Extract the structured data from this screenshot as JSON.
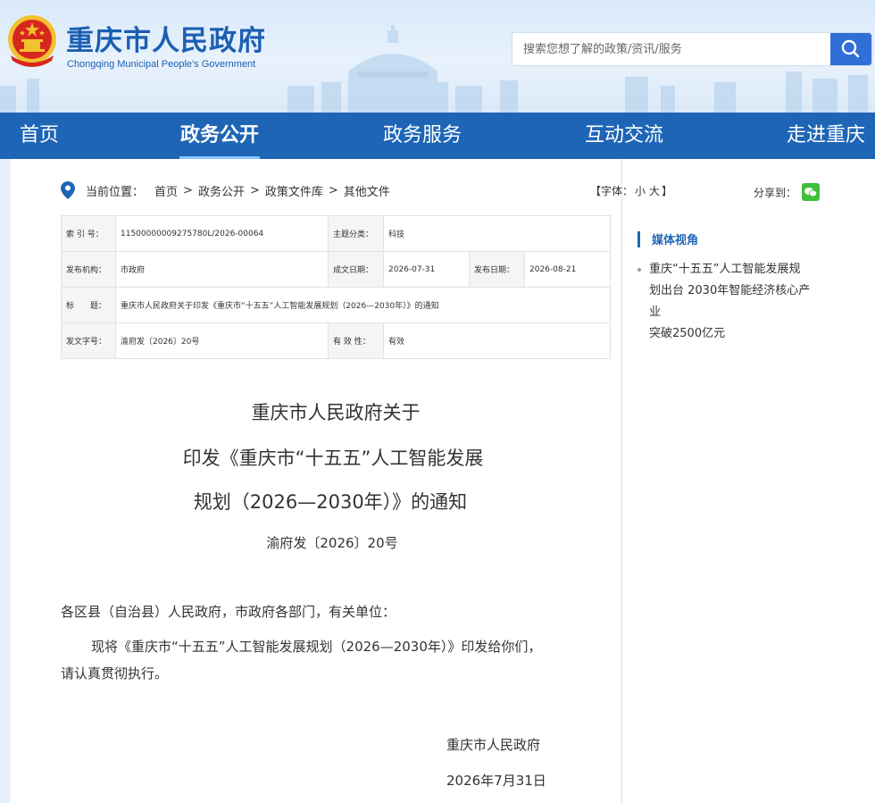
{
  "header": {
    "title": "重庆市人民政府",
    "subtitle": "Chongqing Municipal People's Government",
    "search_placeholder": "搜索您想了解的政策/资讯/服务"
  },
  "nav": [
    {
      "label": "首页",
      "active": false
    },
    {
      "label": "政务公开",
      "active": true
    },
    {
      "label": "政务服务",
      "active": false
    },
    {
      "label": "互动交流",
      "active": false
    },
    {
      "label": "走进重庆",
      "active": false
    }
  ],
  "breadcrumb": {
    "prefix": "当前位置：",
    "items": [
      "首页",
      "政务公开",
      "政策文件库",
      "其他文件"
    ],
    "separator": ">"
  },
  "font_size": {
    "label": "【字体：",
    "small": "小",
    "large": "大",
    "close": "】"
  },
  "share": {
    "label": "分享到："
  },
  "info": {
    "index_label": "索 引 号：",
    "index_value": "11500000009275780L/2026-00064",
    "topic_label": "主题分类：",
    "topic_value": "科技",
    "issuer_label": "发布机构：",
    "issuer_value": "市政府",
    "created_label": "成文日期：",
    "created_value": "2026-07-31",
    "published_label": "发布日期：",
    "published_value": "2026-08-21",
    "title_label": "标　　题：",
    "title_value": "重庆市人民政府关于印发《重庆市“十五五”人工智能发展规划（2026—2030年）》的通知",
    "docno_label": "发文字号：",
    "docno_value": "渝府发〔2026〕20号",
    "validity_label": "有 效 性：",
    "validity_value": "有效"
  },
  "document": {
    "title_lines": [
      "重庆市人民政府关于",
      "印发《重庆市“十五五”人工智能发展",
      "规划（2026—2030年）》的通知"
    ],
    "doc_number": "渝府发〔2026〕20号",
    "salutation": "各区县（自治县）人民政府，市政府各部门，有关单位：",
    "body_line1": "现将《重庆市“十五五”人工智能发展规划（2026—2030年）》印发给你们，",
    "body_line2": "请认真贯彻执行。",
    "signature": "重庆市人民政府",
    "date": "2026年7月31日"
  },
  "sidebar": {
    "section_title": "媒体视角",
    "items": [
      {
        "lines": [
          "重庆“十五五”人工智能发展规",
          "划出台 2030年智能经济核心产业",
          "突破2500亿元"
        ]
      }
    ]
  },
  "colors": {
    "brand_blue": "#1e65b6",
    "search_button": "#2f6fd6",
    "wechat_green": "#3fbf3c",
    "emblem_red": "#d7261e",
    "emblem_gold": "#f2c12e"
  }
}
